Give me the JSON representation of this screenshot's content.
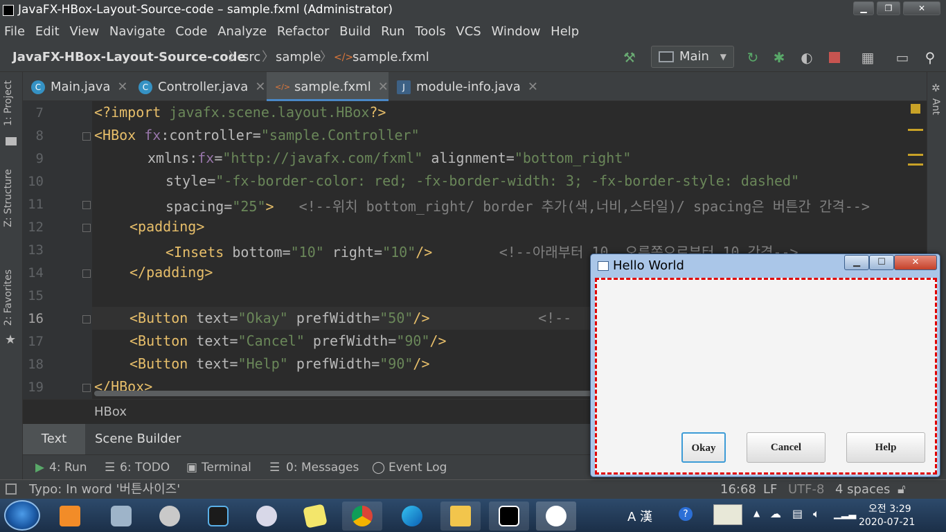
{
  "window": {
    "title": "JavaFX-HBox-Layout-Source-code – sample.fxml (Administrator)",
    "min": "▁",
    "max": "❐",
    "close": "✕"
  },
  "menu": [
    "File",
    "Edit",
    "View",
    "Navigate",
    "Code",
    "Analyze",
    "Refactor",
    "Build",
    "Run",
    "Tools",
    "VCS",
    "Window",
    "Help"
  ],
  "breadcrumb": {
    "project": "JavaFX-HBox-Layout-Source-code",
    "src": "src",
    "pkg": "sample",
    "file": "sample.fxml"
  },
  "toolbar": {
    "run_config": "Main"
  },
  "left_tabs": {
    "project": "1: Project",
    "structure": "Z: Structure",
    "favorites": "2: Favorites"
  },
  "right_tabs": {
    "ant": "Ant"
  },
  "tabs": [
    {
      "label": "Main.java",
      "icon": "C"
    },
    {
      "label": "Controller.java",
      "icon": "C"
    },
    {
      "label": "sample.fxml",
      "icon": "</>"
    },
    {
      "label": "module-info.java",
      "icon": "J"
    }
  ],
  "code": {
    "line_numbers": [
      "7",
      "8",
      "9",
      "10",
      "11",
      "12",
      "13",
      "14",
      "15",
      "16",
      "17",
      "18",
      "19"
    ],
    "l7": {
      "a": "<?import ",
      "b": "javafx.scene.layout.HBox",
      "c": "?>"
    },
    "l8": {
      "tag": "<HBox ",
      "ns": "fx",
      "attr": ":controller=",
      "val": "\"sample.Controller\""
    },
    "l9": {
      "attr1": "xmlns:",
      "ns": "fx",
      "eq": "=",
      "val1": "\"http://javafx.com/fxml\"",
      "attr2": " alignment=",
      "val2": "\"bottom_right\""
    },
    "l10": {
      "attr": "style=",
      "val": "\"-fx-border-color: red; -fx-border-width: 3; -fx-border-style: dashed\""
    },
    "l11": {
      "attr": "spacing=",
      "val": "\"25\"",
      "tag": ">",
      "comment": "<!--위치 bottom_right/ border 추가(색,너비,스타일)/ spacing은 버튼간 간격-->"
    },
    "l12": {
      "tag": "<padding>"
    },
    "l13": {
      "tag": "<Insets ",
      "attr1": "bottom=",
      "val1": "\"10\"",
      "attr2": " right=",
      "val2": "\"10\"",
      "end": "/>",
      "comment": "<!--아래부터 10, 오른쪽으로부터 10 간격-->"
    },
    "l14": {
      "tag": "</padding>"
    },
    "l16": {
      "tag": "<Button ",
      "attr1": "text=",
      "val1": "\"Okay\"",
      "attr2": " prefWidth=",
      "val2": "\"50\"",
      "end": "/>",
      "comment": "<!--"
    },
    "l17": {
      "tag": "<Button ",
      "attr1": "text=",
      "val1": "\"Cancel\"",
      "attr2": " prefWidth=",
      "val2": "\"90\"",
      "end": "/>"
    },
    "l18": {
      "tag": "<Button ",
      "attr1": "text=",
      "val1": "\"Help\"",
      "attr2": " prefWidth=",
      "val2": "\"90\"",
      "end": "/>"
    },
    "l19": {
      "tag": "</HBox>"
    }
  },
  "hbox_breadcrumb": "HBox",
  "editor_mode_tabs": [
    "Text",
    "Scene Builder"
  ],
  "tool_windows": [
    "4: Run",
    "6: TODO",
    "Terminal",
    "0: Messages",
    "Event Log"
  ],
  "status": {
    "message": "Typo: In word '버튼사이즈'",
    "position": "16:68",
    "line_sep": "LF",
    "encoding": "UTF-8",
    "indent": "4 spaces"
  },
  "dialog": {
    "title": "Hello World",
    "buttons": [
      "Okay",
      "Cancel",
      "Help"
    ]
  },
  "tray": {
    "ime": "A 漢",
    "time": "오전 3:29",
    "date": "2020-07-21"
  },
  "colors": {
    "accent": "#4a88c7",
    "border_red": "#e00000"
  }
}
